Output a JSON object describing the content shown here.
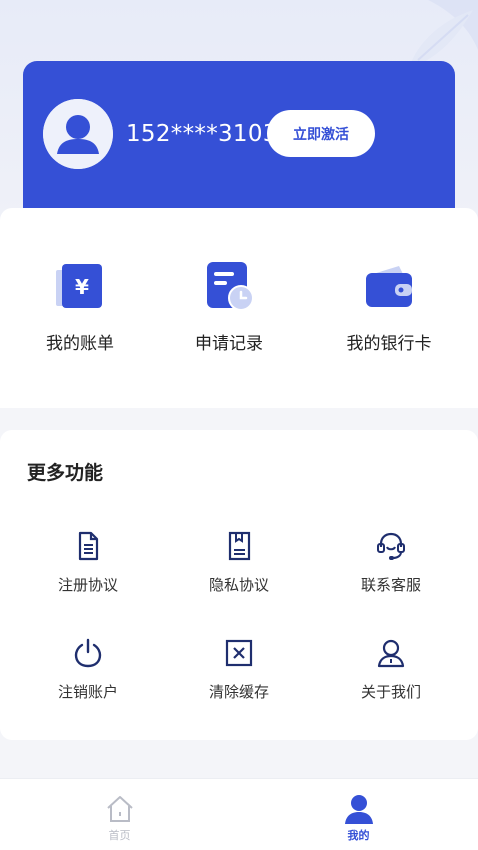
{
  "profile": {
    "phone": "152****3103",
    "activate_label": "立即激活"
  },
  "quick_actions": [
    {
      "label": "我的账单",
      "icon": "bill-icon"
    },
    {
      "label": "申请记录",
      "icon": "application-record-icon"
    },
    {
      "label": "我的银行卡",
      "icon": "wallet-icon"
    }
  ],
  "more": {
    "title": "更多功能",
    "items": [
      {
        "label": "注册协议",
        "icon": "document-icon"
      },
      {
        "label": "隐私协议",
        "icon": "privacy-book-icon"
      },
      {
        "label": "联系客服",
        "icon": "headset-icon"
      },
      {
        "label": "注销账户",
        "icon": "power-icon"
      },
      {
        "label": "清除缓存",
        "icon": "clear-cache-icon"
      },
      {
        "label": "关于我们",
        "icon": "about-user-icon"
      }
    ]
  },
  "tabbar": {
    "items": [
      {
        "label": "首页",
        "icon": "home-icon",
        "active": false
      },
      {
        "label": "我的",
        "icon": "person-icon",
        "active": true
      }
    ]
  },
  "colors": {
    "accent": "#3550d6",
    "icon_dark": "#1f2e6e",
    "tab_inactive": "#b9bcc6"
  }
}
